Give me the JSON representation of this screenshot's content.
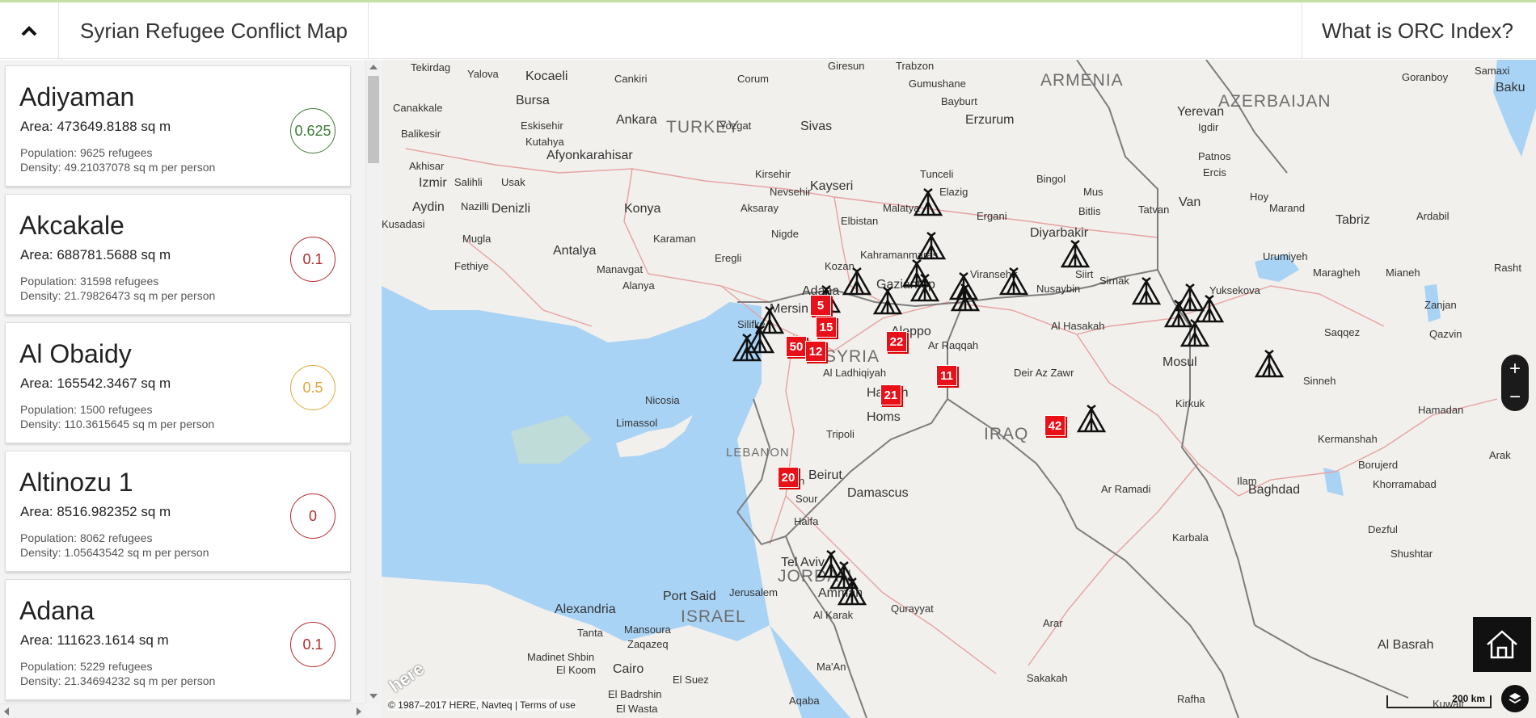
{
  "header": {
    "title": "Syrian Refugee Conflict Map",
    "orc_link": "What is ORC Index?"
  },
  "colors": {
    "green": "#3d7b35",
    "red": "#b42b2b",
    "yellow": "#e0a93a",
    "marker_red": "#e8111a"
  },
  "camps": [
    {
      "name": "Adiyaman",
      "area": "Area: 473649.8188 sq m",
      "population": "Population: 9625 refugees",
      "density": "Density: 49.21037078 sq m per person",
      "score": "0.625",
      "color": "#3d7b35"
    },
    {
      "name": "Akcakale",
      "area": "Area: 688781.5688 sq m",
      "population": "Population: 31598 refugees",
      "density": "Density: 21.79826473 sq m per person",
      "score": "0.1",
      "color": "#b42b2b"
    },
    {
      "name": "Al Obaidy",
      "area": "Area: 165542.3467 sq m",
      "population": "Population: 1500 refugees",
      "density": "Density: 110.3615645 sq m per person",
      "score": "0.5",
      "color": "#e0a93a"
    },
    {
      "name": "Altinozu 1",
      "area": "Area: 8516.982352 sq m",
      "population": "Population: 8062 refugees",
      "density": "Density: 1.05643542 sq m per person",
      "score": "0",
      "color": "#b42b2b"
    },
    {
      "name": "Adana",
      "area": "Area: 111623.1614 sq m",
      "population": "Population: 5229 refugees",
      "density": "Density: 21.34694232 sq m per person",
      "score": "0.1",
      "color": "#b42b2b"
    }
  ],
  "map": {
    "country_labels": [
      "TURKEY",
      "SYRIA",
      "IRAQ",
      "LEBANON",
      "JORDAN",
      "ISRAEL",
      "ARMENIA",
      "AZERBAIJAN"
    ],
    "cities": [
      "Tekirdag",
      "Yalova",
      "Kocaeli",
      "Cankiri",
      "Corum",
      "Giresun",
      "Trabzon",
      "Gumushane",
      "Bayburt",
      "Erzurum",
      "Goranboy",
      "Samaxi",
      "Baku",
      "Bursa",
      "Eskisehir",
      "Ankara",
      "Yozgat",
      "Sivas",
      "Canakkale",
      "Balikesir",
      "Kutahya",
      "Akhisar",
      "Usak",
      "Afyonkarahisar",
      "Izmir",
      "Salihli",
      "Aydin",
      "Nazilli",
      "Denizli",
      "Kusadasi",
      "Mugla",
      "Fethiye",
      "Antalya",
      "Manavgat",
      "Alanya",
      "Konya",
      "Karaman",
      "Eregli",
      "Nigde",
      "Aksaray",
      "Nevsehir",
      "Kirsehir",
      "Kayseri",
      "Elbistan",
      "Malatya",
      "Elazig",
      "Tunceli",
      "Bingol",
      "Mus",
      "Bitlis",
      "Tatvan",
      "Van",
      "Yerevan",
      "Igdir",
      "Patnos",
      "Ercis",
      "Hoy",
      "Marand",
      "Tabriz",
      "Ardabil",
      "Urumiyeh",
      "Maragheh",
      "Mianeh",
      "Rasht",
      "Zanjan",
      "Qazvin",
      "Saqqez",
      "Sinneh",
      "Hamadan",
      "Kermanshah",
      "Arak",
      "Borujerd",
      "Khorramabad",
      "Ilam",
      "Dezful",
      "Shushtar",
      "Al Basrah",
      "Baghdad",
      "Karbala",
      "Ar Ramadi",
      "Kirkuk",
      "Mosul",
      "Yuksekova",
      "Sirnak",
      "Siirt",
      "Diyarbakir",
      "Ergani",
      "Viransehir",
      "Nusaybin",
      "Al Hasakah",
      "Deir Az Zawr",
      "Ar Raqqah",
      "Aleppo",
      "Gaziantep",
      "Kahramanmaras",
      "Adana",
      "Mersin",
      "Silifke",
      "Kozan",
      "Hamah",
      "Homs",
      "Tripoli",
      "Beirut",
      "Sidon",
      "Sour",
      "Damascus",
      "Haifa",
      "Tel Aviv",
      "Jerusalem",
      "Amman",
      "Nicosia",
      "Limassol",
      "Alexandria",
      "Port Said",
      "Tanta",
      "Mansoura",
      "Zaqazeq",
      "Madinet Shbin",
      "El Koom",
      "Cairo",
      "El Suez",
      "El Badrshin",
      "El Wasta",
      "Al Karak",
      "Aqaba",
      "Ma'An",
      "Arar",
      "Sakakah",
      "Rafha",
      "Qurayyat",
      "Al Ladhiqiyah",
      "Kuwait"
    ],
    "markers": [
      "5",
      "15",
      "50",
      "12",
      "22",
      "11",
      "21",
      "42",
      "20"
    ],
    "copyright": "© 1987–2017 HERE, Navteq | Terms of use",
    "scale": "200 km",
    "zoom_in": "+",
    "zoom_out": "−"
  }
}
